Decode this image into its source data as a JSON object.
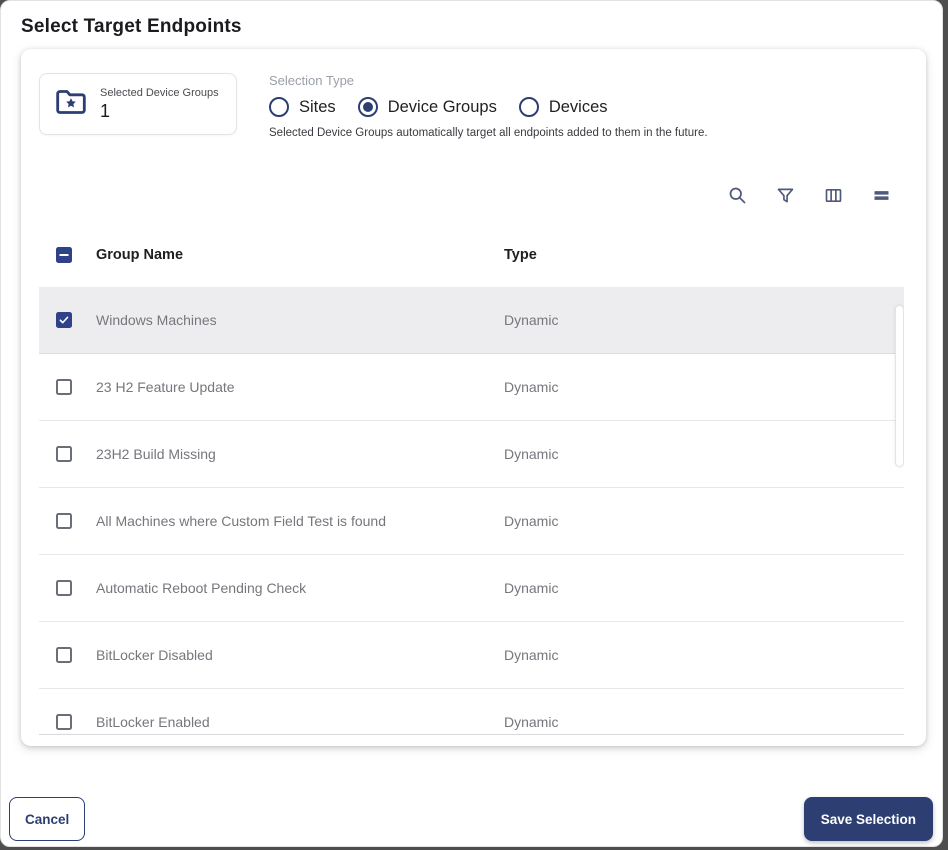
{
  "dialog": {
    "title": "Select Target Endpoints",
    "summary": {
      "label": "Selected Device Groups",
      "value": "1"
    },
    "selection_type": {
      "label": "Selection Type",
      "options": [
        {
          "label": "Sites",
          "selected": false
        },
        {
          "label": "Device Groups",
          "selected": true
        },
        {
          "label": "Devices",
          "selected": false
        }
      ],
      "helper": "Selected Device Groups automatically target all endpoints added to them in the future."
    },
    "table": {
      "toolbar_icons": [
        "search-icon",
        "filter-icon",
        "columns-icon",
        "density-icon"
      ],
      "columns": [
        "Group Name",
        "Type"
      ],
      "header_checkbox_state": "indeterminate",
      "rows": [
        {
          "name": "Windows Machines",
          "type": "Dynamic",
          "checked": true,
          "selected": true
        },
        {
          "name": "23 H2 Feature Update",
          "type": "Dynamic",
          "checked": false,
          "selected": false
        },
        {
          "name": "23H2 Build Missing",
          "type": "Dynamic",
          "checked": false,
          "selected": false
        },
        {
          "name": "All Machines where Custom Field Test is found",
          "type": "Dynamic",
          "checked": false,
          "selected": false
        },
        {
          "name": "Automatic Reboot Pending Check",
          "type": "Dynamic",
          "checked": false,
          "selected": false
        },
        {
          "name": "BitLocker Disabled",
          "type": "Dynamic",
          "checked": false,
          "selected": false
        },
        {
          "name": "BitLocker Enabled",
          "type": "Dynamic",
          "checked": false,
          "selected": false
        }
      ]
    },
    "footer": {
      "cancel_label": "Cancel",
      "save_label": "Save Selection"
    },
    "colors": {
      "accent": "#2c3e72",
      "checkbox_blue": "#2e4189",
      "icon_slate": "#4f5a7a",
      "selected_row_bg": "#ededf0",
      "muted_text": "#76767d"
    }
  }
}
